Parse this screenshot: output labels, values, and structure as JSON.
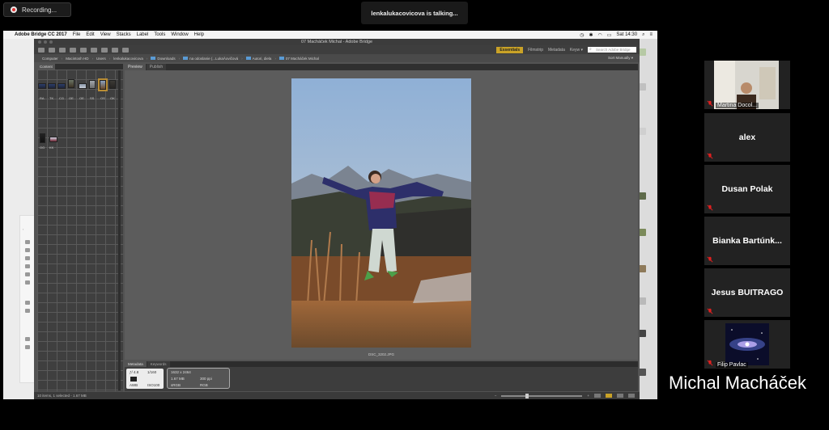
{
  "zoom": {
    "recording_label": "Recording...",
    "talking_label": "lenkalukacovicova is talking...",
    "speaker_name": "Michal Macháček",
    "participants": [
      {
        "name": "Martina Docol...",
        "display": "video",
        "muted": true
      },
      {
        "name": "alex",
        "display": "name",
        "muted": true
      },
      {
        "name": "Dusan Polak",
        "display": "name",
        "muted": true
      },
      {
        "name": "Bianka Bartúnk...",
        "display": "name",
        "muted": true
      },
      {
        "name": "Jesus BUITRAGO",
        "display": "name",
        "muted": true
      },
      {
        "name": "Filip Pavlac",
        "display": "image",
        "muted": true
      }
    ]
  },
  "mac_menu": {
    "app": "Adobe Bridge CC 2017",
    "items": [
      "File",
      "Edit",
      "View",
      "Stacks",
      "Label",
      "Tools",
      "Window",
      "Help"
    ],
    "clock": "Sat 14:30"
  },
  "bridge": {
    "window_title": "07 Macháček Michal - Adobe Bridge",
    "workspaces": [
      "Essentials",
      "Filmstrip",
      "Metadata",
      "Keyw ▾"
    ],
    "search_placeholder": "Search Adobe Bridge",
    "path": [
      "Computer",
      "Macintosh HD",
      "Users",
      "lenkalukacovicova",
      "Downloads",
      "na odoslanie (...LukaÄovičová",
      "Autori, diela",
      "07 Macháček Michal"
    ],
    "sort_label": "Sort Manually ▾",
    "content_tab": "Content",
    "thumb_labels_row1": [
      "RA",
      "TK",
      "CG",
      "OE",
      "OE",
      "SS",
      "OS",
      "OK"
    ],
    "thumb_labels_row2": [
      "OG",
      "KK"
    ],
    "preview_tabs": [
      "Preview",
      "Publish"
    ],
    "photo_caption": "DSC_3202.JPG",
    "metadata_tabs": [
      "Metadata",
      "Keywords"
    ],
    "camera": {
      "aperture": "ƒ/ 4.8",
      "shutter": "1/160",
      "mode": "AWB",
      "iso": "ISO100"
    },
    "file_info": {
      "dimensions": "1632 x 2464",
      "size": "1.67 MB",
      "resolution": "300 ppi",
      "colorspace": "sRGB",
      "mode": "RGB"
    },
    "status_text": "10 items, 1 selected - 1.67 MB"
  },
  "colors": {
    "accent": "#c9a227",
    "bridge_bg": "#535353",
    "mute_red": "#e02020"
  }
}
